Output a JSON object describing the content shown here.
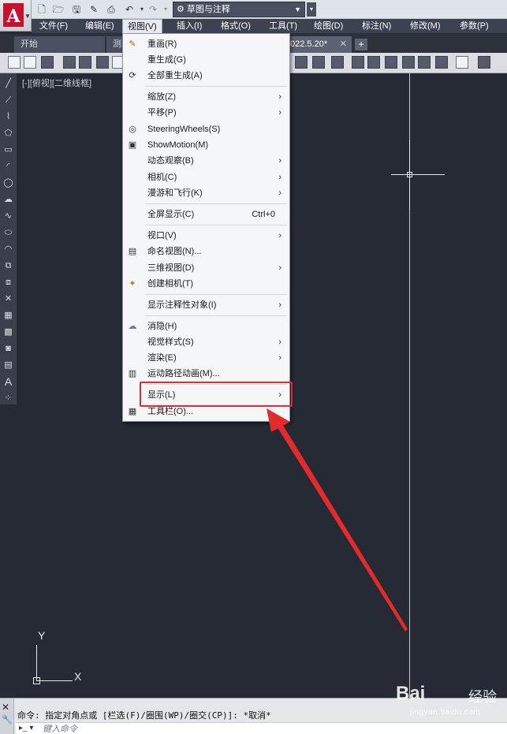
{
  "titlebar": {
    "workspace": "草图与注释"
  },
  "menubar": {
    "items": [
      {
        "label": "文件(F)"
      },
      {
        "label": "编辑(E)"
      },
      {
        "label": "视图(V)"
      },
      {
        "label": "插入(I)"
      },
      {
        "label": "格式(O)"
      },
      {
        "label": "工具(T)"
      },
      {
        "label": "绘图(D)"
      },
      {
        "label": "标注(N)"
      },
      {
        "label": "修改(M)"
      },
      {
        "label": "参数(P)"
      }
    ]
  },
  "tabs": [
    {
      "label": "开始"
    },
    {
      "label": "测"
    },
    {
      "label": "022.5.20*"
    }
  ],
  "canvas": {
    "viewport_label": "[-][俯视][二维线框]",
    "ucs_x": "X",
    "ucs_y": "Y"
  },
  "view_menu": {
    "items": [
      {
        "label": "重画(R)",
        "icon": "pencil-icon"
      },
      {
        "label": "重生成(G)"
      },
      {
        "label": "全部重生成(A)",
        "icon": "regen-all-icon"
      },
      {
        "label": "缩放(Z)",
        "submenu": true
      },
      {
        "label": "平移(P)",
        "submenu": true
      },
      {
        "label": "SteeringWheels(S)",
        "icon": "steering-wheel-icon"
      },
      {
        "label": "ShowMotion(M)",
        "icon": "showmotion-icon"
      },
      {
        "label": "动态观察(B)",
        "submenu": true
      },
      {
        "label": "相机(C)",
        "submenu": true
      },
      {
        "label": "漫游和飞行(K)",
        "submenu": true
      },
      {
        "label": "全屏显示(C)",
        "shortcut": "Ctrl+0"
      },
      {
        "label": "视口(V)",
        "submenu": true
      },
      {
        "label": "命名视图(N)...",
        "icon": "named-view-icon"
      },
      {
        "label": "三维视图(D)",
        "submenu": true
      },
      {
        "label": "创建相机(T)",
        "icon": "camera-icon"
      },
      {
        "label": "显示注释性对象(I)",
        "submenu": true
      },
      {
        "label": "消隐(H)",
        "icon": "hide-icon"
      },
      {
        "label": "视觉样式(S)",
        "submenu": true
      },
      {
        "label": "渲染(E)",
        "submenu": true
      },
      {
        "label": "运动路径动画(M)...",
        "icon": "motion-path-icon"
      },
      {
        "label": "显示(L)",
        "submenu": true
      },
      {
        "label": "工具栏(O)...",
        "icon": "toolbar-icon"
      }
    ]
  },
  "command": {
    "history": "命令: 指定对角点或 [栏选(F)/圈围(WP)/圈交(CP)]: *取消*",
    "placeholder": "键入命令"
  },
  "watermark": {
    "logo": "Bai",
    "brand": "经验",
    "url": "jingyan.baidu.com"
  },
  "colors": {
    "canvas_bg": "#252a34",
    "highlight": "#e42a2a",
    "arrow": "#e42a2a"
  }
}
